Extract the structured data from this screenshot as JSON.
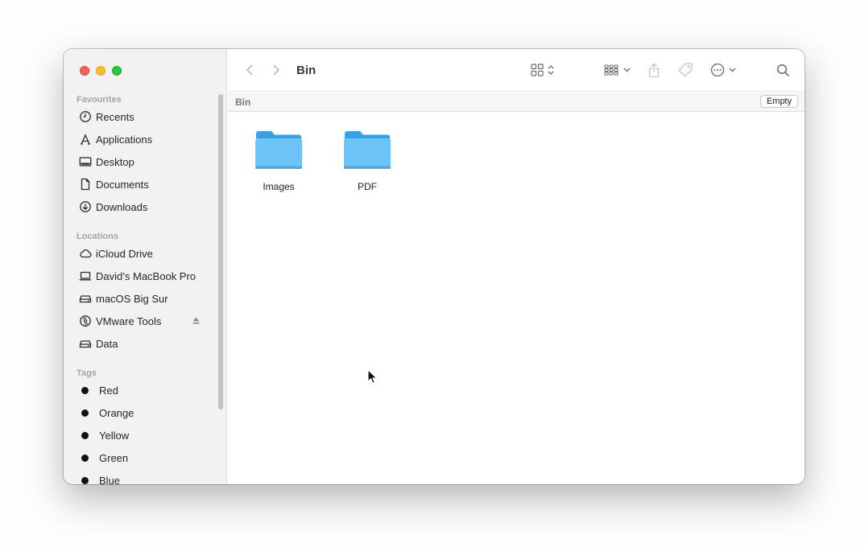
{
  "window": {
    "title": "Bin",
    "traffic_lights": {
      "close": "#fe5f57",
      "minimize": "#febc2e",
      "maximize": "#28c840"
    }
  },
  "sidebar": {
    "favourites": {
      "title": "Favourites",
      "items": [
        {
          "label": "Recents",
          "icon": "clock-icon"
        },
        {
          "label": "Applications",
          "icon": "applications-icon"
        },
        {
          "label": "Desktop",
          "icon": "desktop-icon"
        },
        {
          "label": "Documents",
          "icon": "document-icon"
        },
        {
          "label": "Downloads",
          "icon": "download-icon"
        }
      ]
    },
    "locations": {
      "title": "Locations",
      "items": [
        {
          "label": "iCloud Drive",
          "icon": "cloud-icon"
        },
        {
          "label": "David’s MacBook Pro",
          "icon": "laptop-icon"
        },
        {
          "label": "macOS Big Sur",
          "icon": "drive-icon"
        },
        {
          "label": "VMware Tools",
          "icon": "disc-icon",
          "ejectable": true
        },
        {
          "label": "Data",
          "icon": "drive-icon"
        }
      ]
    },
    "tags": {
      "title": "Tags",
      "items": [
        {
          "label": "Red"
        },
        {
          "label": "Orange"
        },
        {
          "label": "Yellow"
        },
        {
          "label": "Green"
        },
        {
          "label": "Blue"
        }
      ]
    }
  },
  "pathbar": {
    "label": "Bin",
    "empty_label": "Empty"
  },
  "files": [
    {
      "name": "Images",
      "type": "folder"
    },
    {
      "name": "PDF",
      "type": "folder"
    }
  ],
  "colors": {
    "folder_body": "#6cc4f8",
    "folder_tab": "#3aa0e2",
    "tag_dot": "#111111"
  }
}
